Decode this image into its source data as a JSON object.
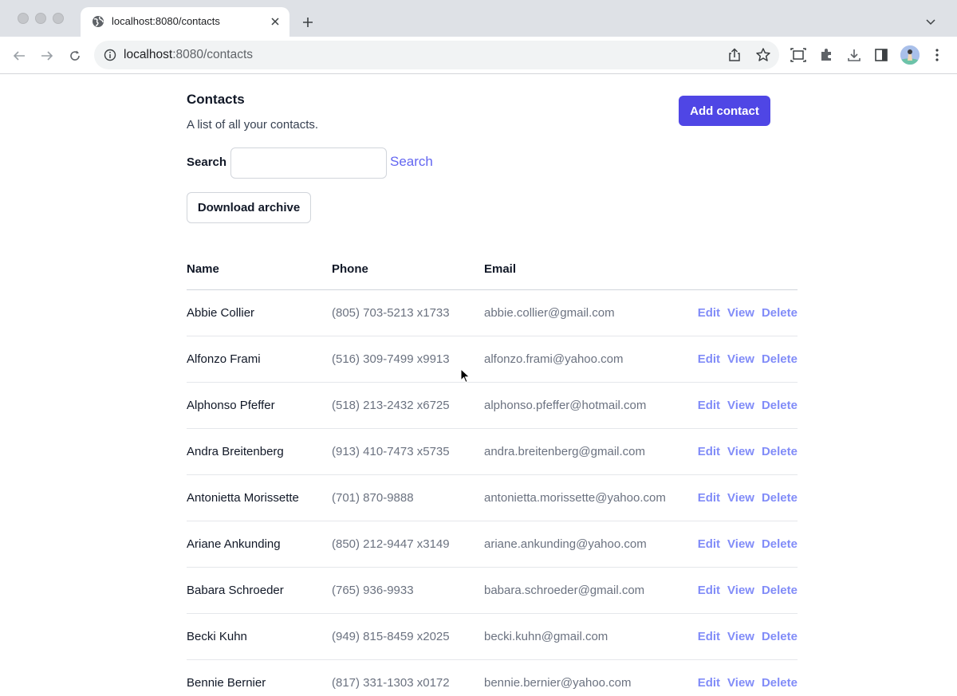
{
  "browser": {
    "tab_title": "localhost:8080/contacts",
    "url_host": "localhost",
    "url_rest": ":8080/contacts"
  },
  "header": {
    "title": "Contacts",
    "subtitle": "A list of all your contacts.",
    "add_button": "Add contact"
  },
  "search": {
    "label": "Search",
    "value": "",
    "button": "Search"
  },
  "download_button": "Download archive",
  "table": {
    "columns": [
      "Name",
      "Phone",
      "Email"
    ],
    "action_labels": [
      "Edit",
      "View",
      "Delete"
    ],
    "rows": [
      {
        "name": "Abbie Collier",
        "phone": "(805) 703-5213 x1733",
        "email": "abbie.collier@gmail.com"
      },
      {
        "name": "Alfonzo Frami",
        "phone": "(516) 309-7499 x9913",
        "email": "alfonzo.frami@yahoo.com"
      },
      {
        "name": "Alphonso Pfeffer",
        "phone": "(518) 213-2432 x6725",
        "email": "alphonso.pfeffer@hotmail.com"
      },
      {
        "name": "Andra Breitenberg",
        "phone": "(913) 410-7473 x5735",
        "email": "andra.breitenberg@gmail.com"
      },
      {
        "name": "Antonietta Morissette",
        "phone": "(701) 870-9888",
        "email": "antonietta.morissette@yahoo.com"
      },
      {
        "name": "Ariane Ankunding",
        "phone": "(850) 212-9447 x3149",
        "email": "ariane.ankunding@yahoo.com"
      },
      {
        "name": "Babara Schroeder",
        "phone": "(765) 936-9933",
        "email": "babara.schroeder@gmail.com"
      },
      {
        "name": "Becki Kuhn",
        "phone": "(949) 815-8459 x2025",
        "email": "becki.kuhn@gmail.com"
      },
      {
        "name": "Bennie Bernier",
        "phone": "(817) 331-1303 x0172",
        "email": "bennie.bernier@yahoo.com"
      }
    ]
  },
  "colors": {
    "primary": "#4f46e5",
    "link": "#818cf8",
    "search_link": "#6366f1"
  }
}
